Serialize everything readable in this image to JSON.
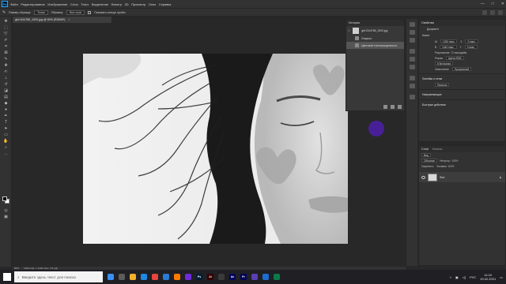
{
  "menubar": {
    "logo": "Ps",
    "items": [
      "Файл",
      "Редактирование",
      "Изображение",
      "Слои",
      "Текст",
      "Выделение",
      "Фильтр",
      "3D",
      "Просмотр",
      "Окно",
      "Справка"
    ],
    "window_controls": [
      "—",
      "□",
      "✕"
    ]
  },
  "options": {
    "tool_label": "Размер образца:",
    "sample_size": "Точка",
    "sample_label": "Образец:",
    "sample_value": "Все слои",
    "show_ring_label": "Показать кольцо пробы"
  },
  "doc_tab": {
    "title": "gbr1344766_1920.jpg @ 50% (RGB/8*)",
    "close": "×"
  },
  "history": {
    "title": "История",
    "snapshot_name": "gbr1344766_1920.jpg",
    "steps": [
      "Открыть",
      "Цветовой тон/насыщенность"
    ]
  },
  "properties": {
    "title": "Свойства",
    "doc_label": "Документ",
    "canvas_section": "Холст",
    "width_label": "Ш",
    "width_value": "1920 пикс.",
    "height_label": "В",
    "height_value": "1440 пикс.",
    "x_label": "X",
    "x_value": "0 пикс.",
    "y_label": "Y",
    "y_value": "0 пикс.",
    "resolution_label": "Разрешение: 72 пикс/дюйм",
    "mode_label": "Режим",
    "mode_value": "Цвета RGB",
    "depth_value": "8 бит/канал",
    "bg_label": "Заполнение",
    "bg_value": "Прозрачный",
    "rulers_section": "Линейки и сетки",
    "rulers_unit": "Пиксели",
    "guides_section": "Направляющие",
    "quick_section": "Быстрые действия"
  },
  "layers": {
    "tabs": [
      "Слои",
      "Каналы"
    ],
    "kind_label": "Вид",
    "blend_mode": "Обычные",
    "opacity_label": "Непрозр.: 100%",
    "lock_label": "Закрепить:",
    "fill_label": "Заливка: 100%",
    "layer_name": "Фон"
  },
  "status": {
    "zoom": "50%",
    "doc_info": "1920 пикс. x 1440 пикс. (72 ppi)"
  },
  "taskbar": {
    "search_placeholder": "Введите здесь текст для поиска",
    "apps": [
      {
        "label": "",
        "color": "#3a8ef6"
      },
      {
        "label": "",
        "color": "#5b5b5b"
      },
      {
        "label": "",
        "color": "#f1b12b"
      },
      {
        "label": "",
        "color": "#1e88e5"
      },
      {
        "label": "",
        "color": "#e8453c"
      },
      {
        "label": "",
        "color": "#2b7bd1"
      },
      {
        "label": "",
        "color": "#ff7a00"
      },
      {
        "label": "",
        "color": "#6e2bd9"
      },
      {
        "label": "Ps",
        "color": "#001e36"
      },
      {
        "label": "Ai",
        "color": "#330000"
      },
      {
        "label": "",
        "color": "#3a3a3a"
      },
      {
        "label": "Ae",
        "color": "#00005b"
      },
      {
        "label": "Pr",
        "color": "#00005b"
      },
      {
        "label": "",
        "color": "#5a3fb5"
      },
      {
        "label": "",
        "color": "#1c6dd0"
      },
      {
        "label": "",
        "color": "#0a7a4a"
      }
    ],
    "lang": "РУС",
    "time": "14:10",
    "date": "19.02.2021"
  }
}
